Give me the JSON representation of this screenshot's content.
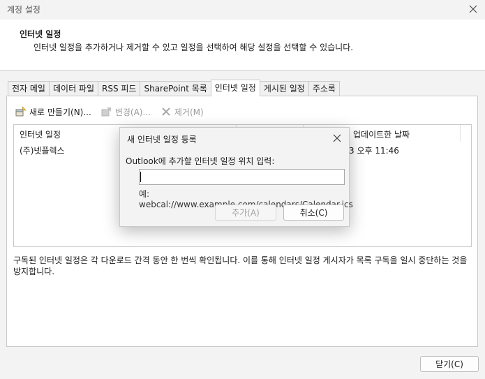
{
  "window": {
    "title": "계정 설정"
  },
  "header": {
    "title": "인터넷 일정",
    "description": "인터넷 일정을 추가하거나 제거할 수 있고 일정을 선택하여 해당 설정을 선택할 수 있습니다."
  },
  "tabs": [
    {
      "label": "전자 메일"
    },
    {
      "label": "데이터 파일"
    },
    {
      "label": "RSS 피드"
    },
    {
      "label": "SharePoint 목록"
    },
    {
      "label": "인터넷 일정",
      "active": true
    },
    {
      "label": "게시된 일정"
    },
    {
      "label": "주소록"
    }
  ],
  "toolbar": {
    "new_label": "새로 만들기(N)...",
    "change_label": "변경(A)...",
    "remove_label": "제거(M)"
  },
  "list": {
    "columns": [
      "인터넷 일정",
      "업데이트한 날짜"
    ],
    "rows": [
      {
        "name": "(주)넷플렉스",
        "updated": "3 오후 11:46"
      }
    ]
  },
  "footnote": "구독된 인터넷 일정은 각 다운로드 간격 동안 한 번씩 확인됩니다. 이를 통해 인터넷 일정 게시자가 목록 구독을 일시 중단하는 것을 방지합니다.",
  "close_button": "닫기(C)",
  "dialog": {
    "title": "새 인터넷 일정 등록",
    "prompt": "Outlook에 추가할 인터넷 일정 위치 입력:",
    "input_value": "",
    "example": "예: webcal://www.example.com/calendars/Calendar.ics",
    "add_label": "추가(A)",
    "cancel_label": "취소(C)"
  }
}
